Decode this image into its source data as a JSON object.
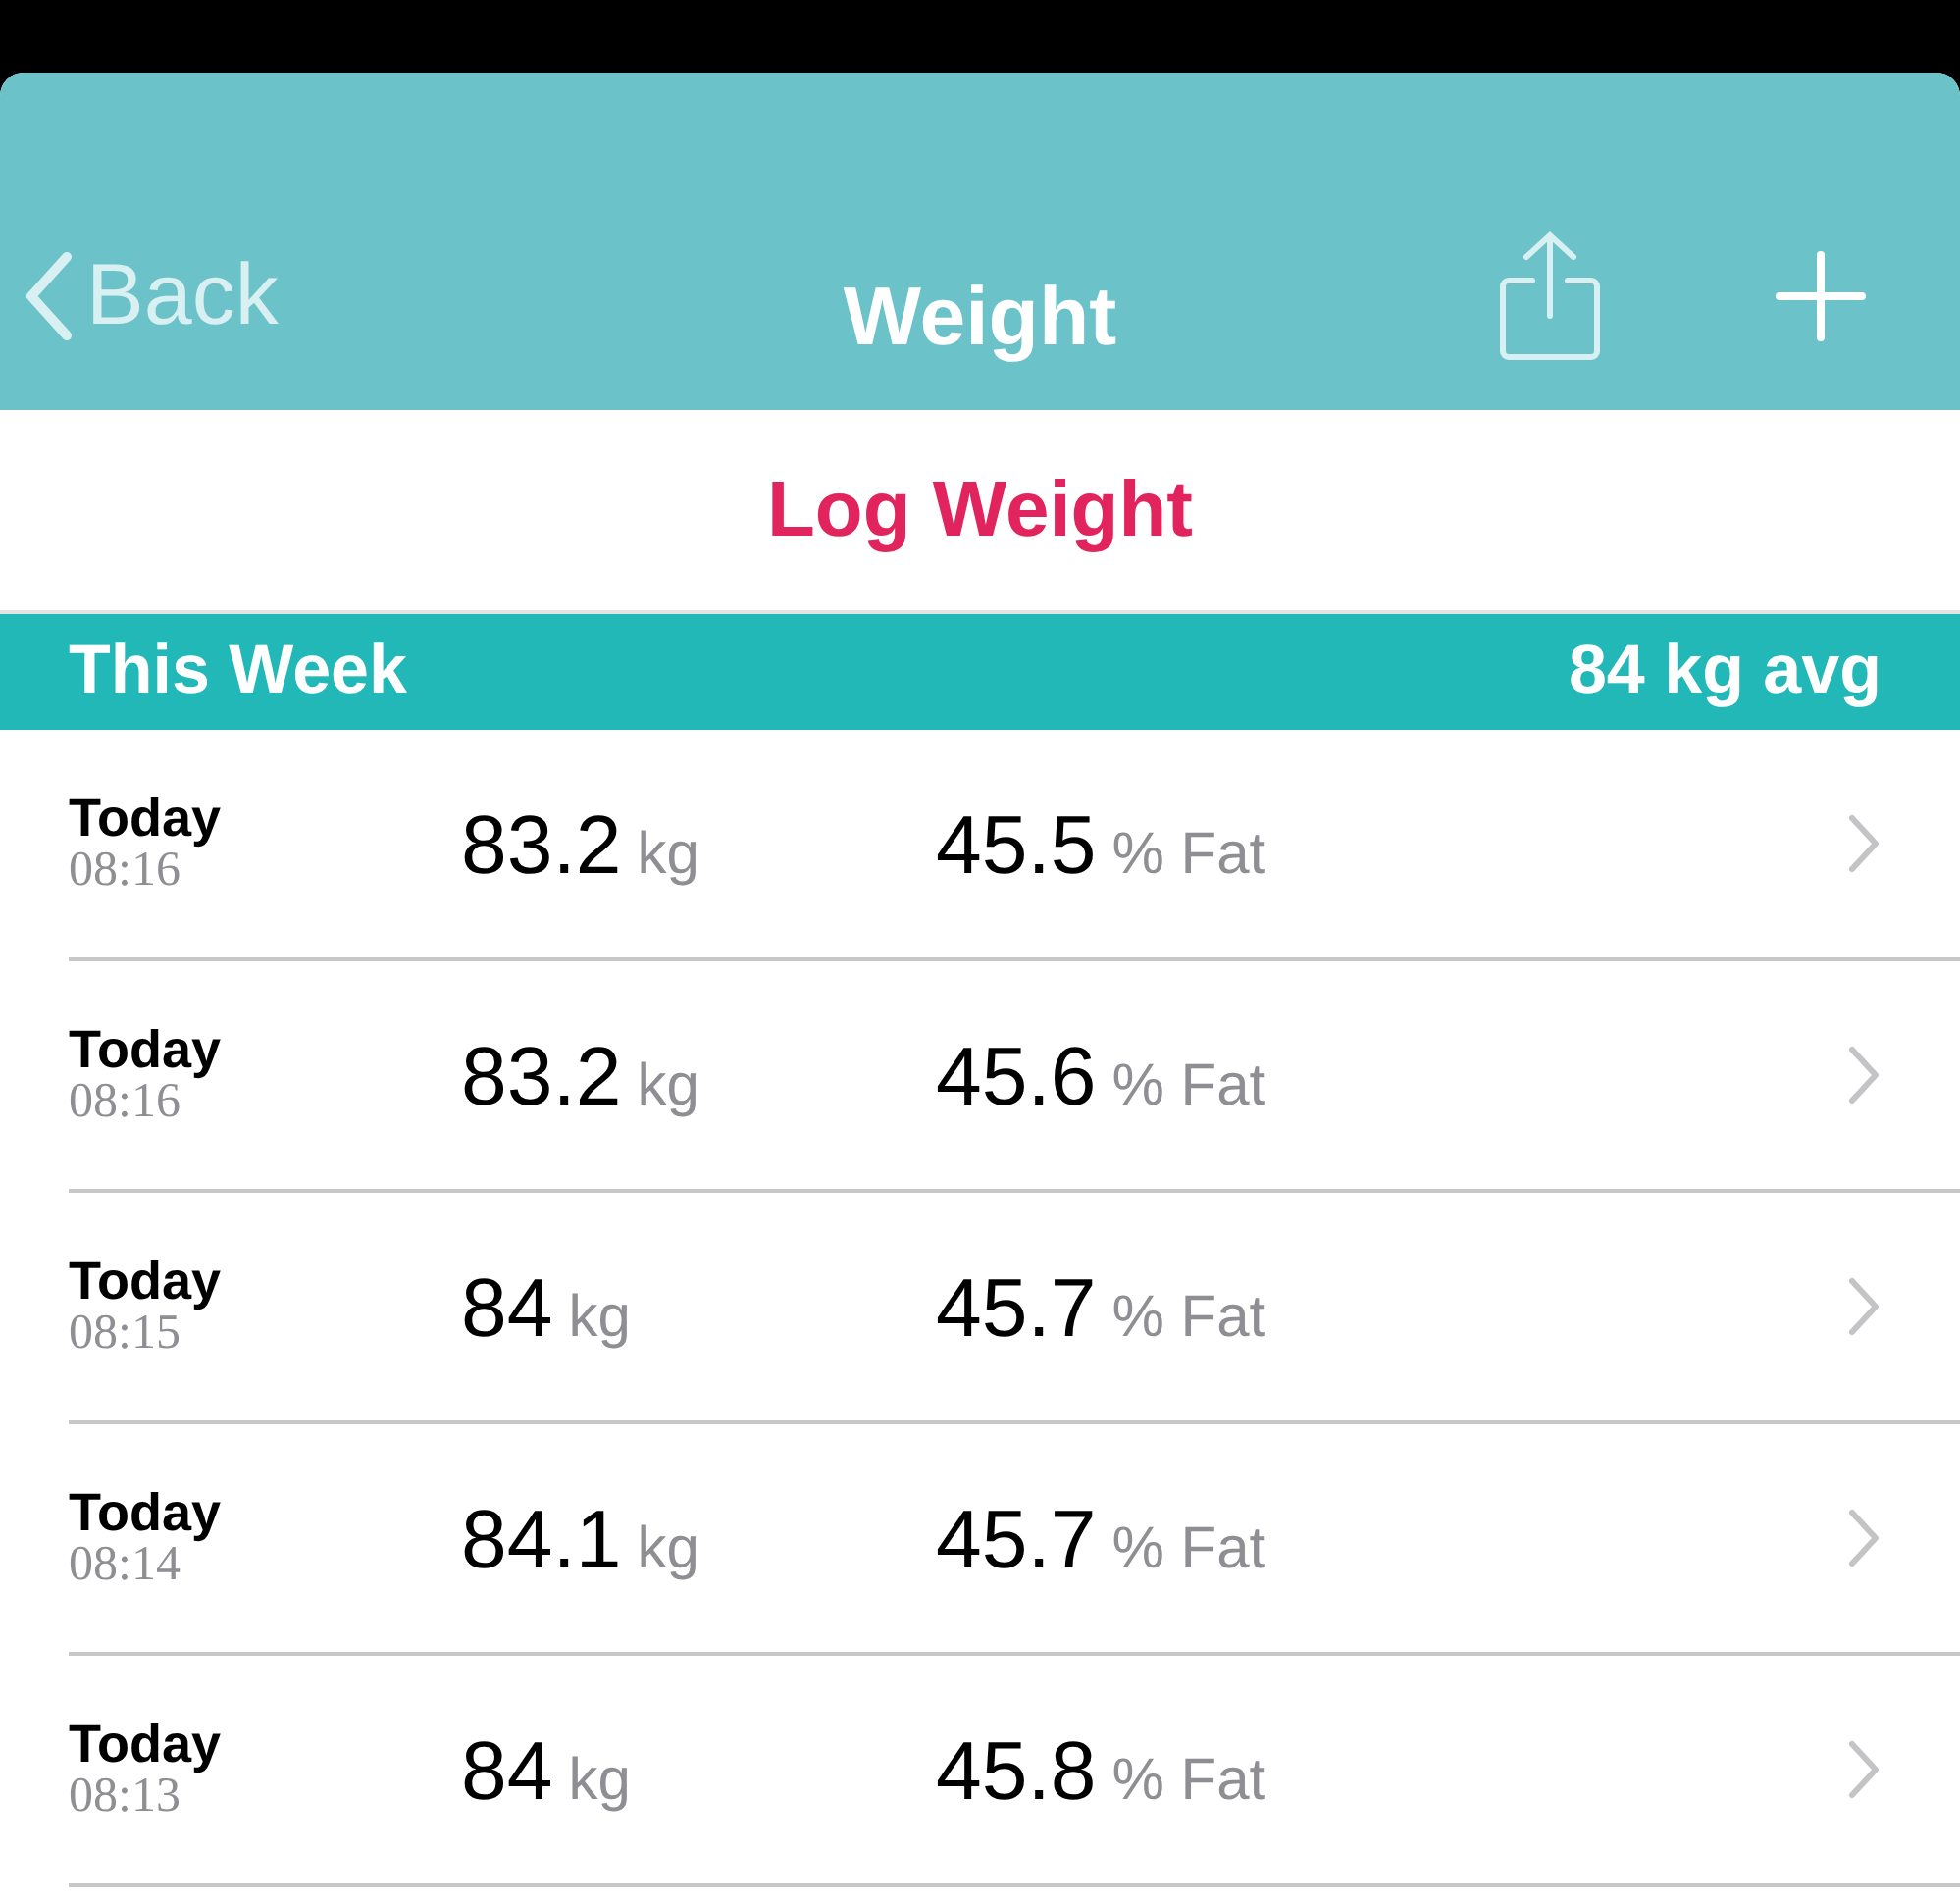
{
  "nav": {
    "back": "Back",
    "title": "Weight"
  },
  "log_button": "Log Weight",
  "section": {
    "title": "This Week",
    "average": "84 kg avg"
  },
  "entries": [
    {
      "day": "Today",
      "time": "08:16",
      "weight": "83.2",
      "weight_unit": "kg",
      "fat": "45.5",
      "fat_unit": "% Fat"
    },
    {
      "day": "Today",
      "time": "08:16",
      "weight": "83.2",
      "weight_unit": "kg",
      "fat": "45.6",
      "fat_unit": "% Fat"
    },
    {
      "day": "Today",
      "time": "08:15",
      "weight": "84",
      "weight_unit": "kg",
      "fat": "45.7",
      "fat_unit": "% Fat"
    },
    {
      "day": "Today",
      "time": "08:14",
      "weight": "84.1",
      "weight_unit": "kg",
      "fat": "45.7",
      "fat_unit": "% Fat"
    },
    {
      "day": "Today",
      "time": "08:13",
      "weight": "84",
      "weight_unit": "kg",
      "fat": "45.8",
      "fat_unit": "% Fat"
    }
  ]
}
